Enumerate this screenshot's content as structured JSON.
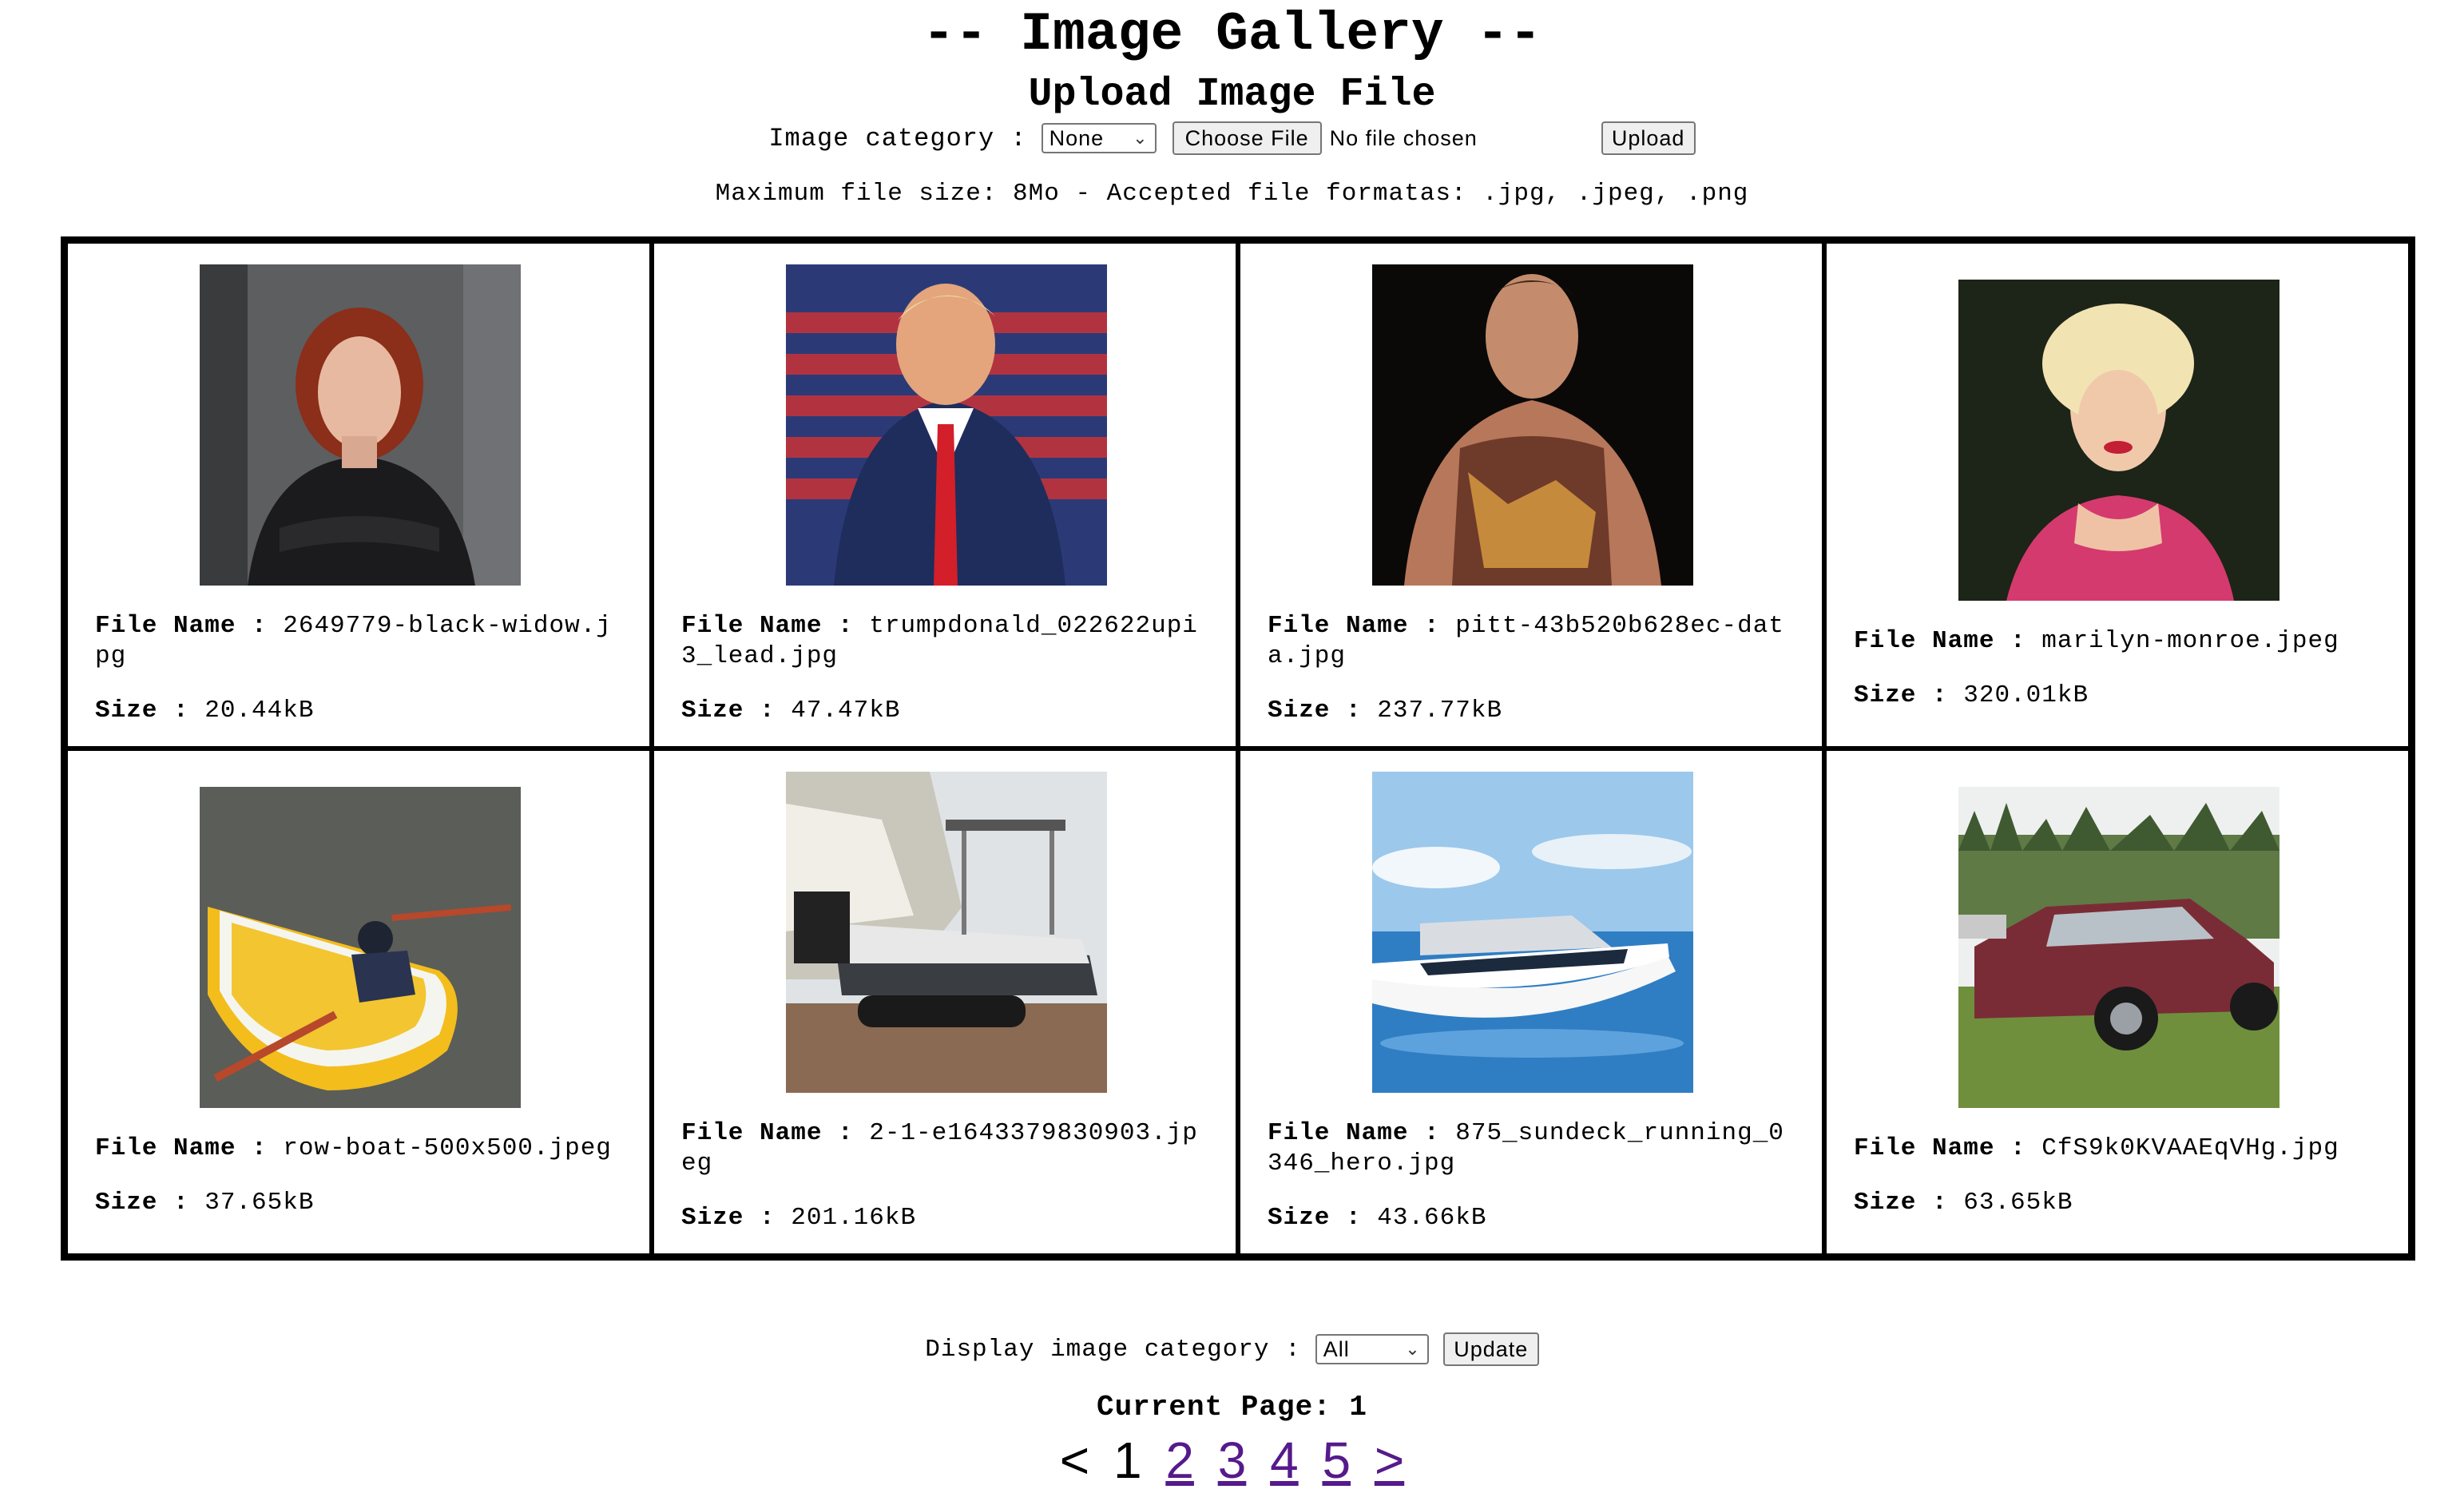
{
  "page": {
    "title": "-- Image Gallery --",
    "upload_heading": "Upload Image File",
    "category_label": "Image category :",
    "category_value": "None",
    "choose_file_label": "Choose File",
    "no_file_text": "No file chosen",
    "upload_button": "Upload",
    "limits_text": "Maximum file size: 8Mo - Accepted file formatas: .jpg, .jpeg, .png"
  },
  "gallery": {
    "file_name_label": "File Name :",
    "size_label": "Size :",
    "items": [
      {
        "file_name": "2649779-black-widow.jpg",
        "size": "20.44kB"
      },
      {
        "file_name": "trumpdonald_022622upi3_lead.jpg",
        "size": "47.47kB"
      },
      {
        "file_name": "pitt-43b520b628ec-data.jpg",
        "size": "237.77kB"
      },
      {
        "file_name": "marilyn-monroe.jpeg",
        "size": "320.01kB"
      },
      {
        "file_name": "row-boat-500x500.jpeg",
        "size": "37.65kB"
      },
      {
        "file_name": "2-1-e1643379830903.jpeg",
        "size": "201.16kB"
      },
      {
        "file_name": "875_sundeck_running_0346_hero.jpg",
        "size": "43.66kB"
      },
      {
        "file_name": "CfS9k0KVAAEqVHg.jpg",
        "size": "63.65kB"
      }
    ]
  },
  "footer": {
    "display_label": "Display image category :",
    "display_value": "All",
    "update_button": "Update",
    "current_page_text": "Current Page: 1",
    "pager": {
      "prev": "<",
      "current": "1",
      "pages": [
        "2",
        "3",
        "4",
        "5"
      ],
      "next": ">"
    }
  }
}
